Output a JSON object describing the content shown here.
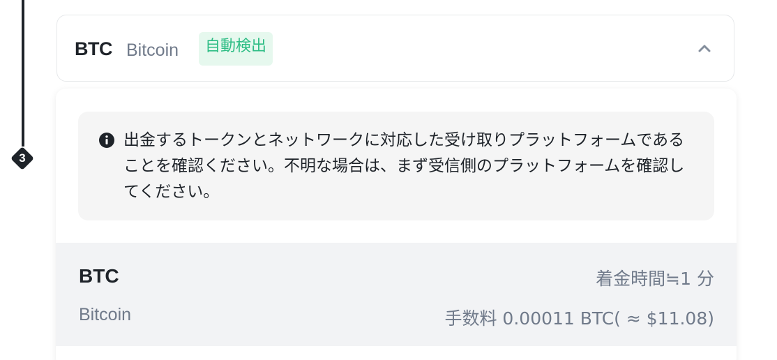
{
  "step": {
    "number": "3"
  },
  "selected": {
    "symbol": "BTC",
    "name": "Bitcoin",
    "tag": "自動検出"
  },
  "notice": {
    "icon": "info-icon",
    "text": "出金するトークンとネットワークに対応した受け取りプラットフォームであることを確認ください。不明な場合は、まず受信側のプラットフォームを確認してください。"
  },
  "options": [
    {
      "symbol": "BTC",
      "name": "Bitcoin",
      "arrival": "着金時間≒1 分",
      "fee": "手数料 0.00011 BTC( ≈ $11.08)"
    }
  ],
  "colors": {
    "tag_bg": "#e6f8ee",
    "tag_text": "#2ebd85",
    "primary_text": "#1e2329",
    "secondary_text": "#707a8a"
  }
}
